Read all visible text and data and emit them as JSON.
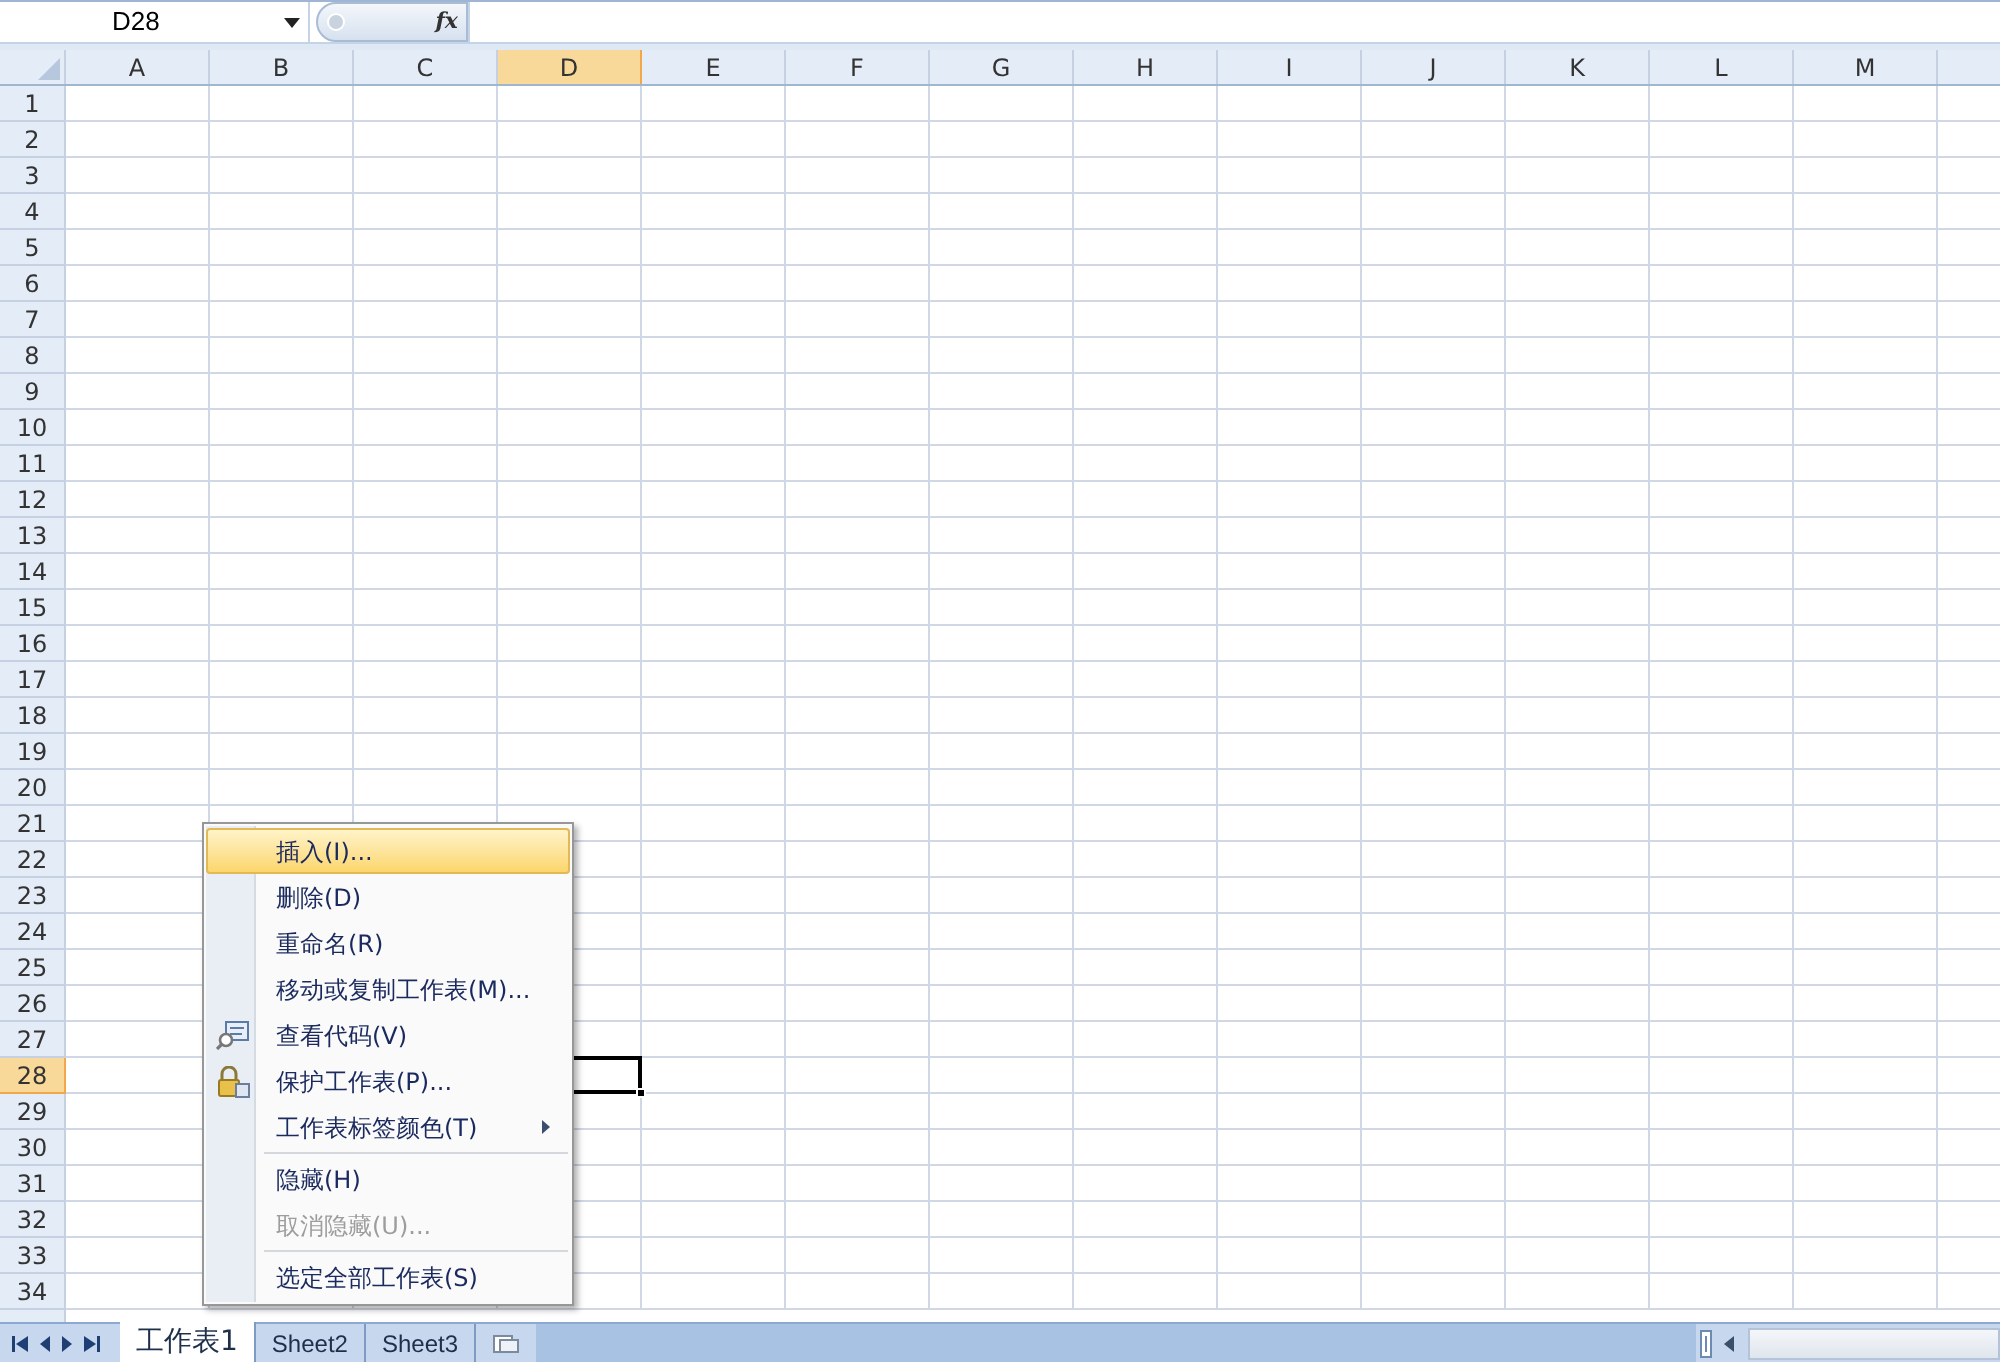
{
  "name_box": {
    "value": "D28"
  },
  "formula_bar": {
    "function_button": "fx"
  },
  "columns": [
    {
      "label": "A",
      "selected": false
    },
    {
      "label": "B",
      "selected": false
    },
    {
      "label": "C",
      "selected": false
    },
    {
      "label": "D",
      "selected": true
    },
    {
      "label": "E",
      "selected": false
    },
    {
      "label": "F",
      "selected": false
    },
    {
      "label": "G",
      "selected": false
    },
    {
      "label": "H",
      "selected": false
    },
    {
      "label": "I",
      "selected": false
    },
    {
      "label": "J",
      "selected": false
    },
    {
      "label": "K",
      "selected": false
    },
    {
      "label": "L",
      "selected": false
    },
    {
      "label": "M",
      "selected": false
    }
  ],
  "rows": [
    {
      "label": "1",
      "selected": false
    },
    {
      "label": "2",
      "selected": false
    },
    {
      "label": "3",
      "selected": false
    },
    {
      "label": "4",
      "selected": false
    },
    {
      "label": "5",
      "selected": false
    },
    {
      "label": "6",
      "selected": false
    },
    {
      "label": "7",
      "selected": false
    },
    {
      "label": "8",
      "selected": false
    },
    {
      "label": "9",
      "selected": false
    },
    {
      "label": "10",
      "selected": false
    },
    {
      "label": "11",
      "selected": false
    },
    {
      "label": "12",
      "selected": false
    },
    {
      "label": "13",
      "selected": false
    },
    {
      "label": "14",
      "selected": false
    },
    {
      "label": "15",
      "selected": false
    },
    {
      "label": "16",
      "selected": false
    },
    {
      "label": "17",
      "selected": false
    },
    {
      "label": "18",
      "selected": false
    },
    {
      "label": "19",
      "selected": false
    },
    {
      "label": "20",
      "selected": false
    },
    {
      "label": "21",
      "selected": false
    },
    {
      "label": "22",
      "selected": false
    },
    {
      "label": "23",
      "selected": false
    },
    {
      "label": "24",
      "selected": false
    },
    {
      "label": "25",
      "selected": false
    },
    {
      "label": "26",
      "selected": false
    },
    {
      "label": "27",
      "selected": false
    },
    {
      "label": "28",
      "selected": true
    },
    {
      "label": "29",
      "selected": false
    },
    {
      "label": "30",
      "selected": false
    },
    {
      "label": "31",
      "selected": false
    },
    {
      "label": "32",
      "selected": false
    },
    {
      "label": "33",
      "selected": false
    },
    {
      "label": "34",
      "selected": false
    }
  ],
  "context_menu": {
    "items": [
      {
        "label": "插入(I)...",
        "kind": "plain",
        "selected": true,
        "disabled": false,
        "separator_before": false
      },
      {
        "label": "删除(D)",
        "kind": "plain",
        "selected": false,
        "disabled": false,
        "separator_before": false
      },
      {
        "label": "重命名(R)",
        "kind": "plain",
        "selected": false,
        "disabled": false,
        "separator_before": false
      },
      {
        "label": "移动或复制工作表(M)...",
        "kind": "plain",
        "selected": false,
        "disabled": false,
        "separator_before": false
      },
      {
        "label": "查看代码(V)",
        "kind": "code",
        "selected": false,
        "disabled": false,
        "separator_before": false
      },
      {
        "label": "保护工作表(P)...",
        "kind": "protect",
        "selected": false,
        "disabled": false,
        "separator_before": false
      },
      {
        "label": "工作表标签颜色(T)",
        "kind": "submenu",
        "selected": false,
        "disabled": false,
        "separator_before": false
      },
      {
        "label": "隐藏(H)",
        "kind": "plain",
        "selected": false,
        "disabled": false,
        "separator_before": true
      },
      {
        "label": "取消隐藏(U)...",
        "kind": "plain",
        "selected": false,
        "disabled": true,
        "separator_before": false
      },
      {
        "label": "选定全部工作表(S)",
        "kind": "plain",
        "selected": false,
        "disabled": false,
        "separator_before": true
      }
    ]
  },
  "sheet_tabs": [
    {
      "label": "工作表1",
      "selected": true
    },
    {
      "label": "Sheet2",
      "selected": false
    },
    {
      "label": "Sheet3",
      "selected": false
    }
  ]
}
